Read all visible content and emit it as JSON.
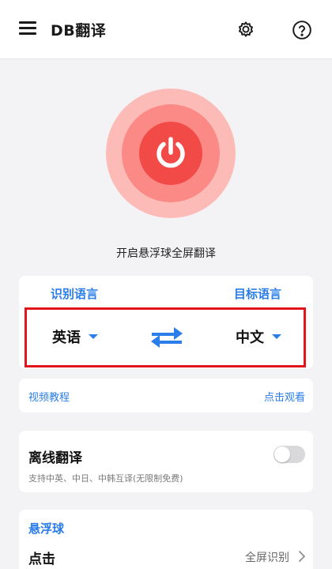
{
  "app": {
    "title": "DB翻译"
  },
  "header": {
    "menu_icon": "menu-icon",
    "settings_icon": "gear-icon",
    "help_icon": "help-icon"
  },
  "power": {
    "caption": "开启悬浮球全屏翻译",
    "icon": "power-icon",
    "colors": {
      "outer": "#fdbbb8",
      "middle": "#fb8986",
      "inner": "#f24a47"
    }
  },
  "languages": {
    "source_label": "识别语言",
    "target_label": "目标语言",
    "source_value": "英语",
    "target_value": "中文",
    "swap_icon": "swap-arrows-icon"
  },
  "tutorial": {
    "label": "视频教程",
    "action": "点击观看"
  },
  "offline": {
    "title": "离线翻译",
    "description": "支持中英、中日、中韩互译(无限制免费)",
    "enabled": false
  },
  "floating_ball": {
    "title": "悬浮球",
    "row_label": "点击",
    "row_value": "全屏识别"
  },
  "colors": {
    "accent": "#2b7de9",
    "highlight_border": "#e3141a",
    "background": "#f3f3f5"
  }
}
